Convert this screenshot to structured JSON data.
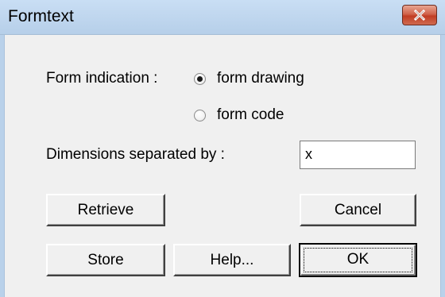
{
  "window": {
    "title": "Formtext"
  },
  "form": {
    "indication_label": "Form indication :",
    "options": [
      {
        "label": "form drawing",
        "selected": true
      },
      {
        "label": "form code",
        "selected": false
      }
    ],
    "separator_label": "Dimensions separated by :",
    "separator_value": "x"
  },
  "buttons": {
    "retrieve": "Retrieve",
    "cancel": "Cancel",
    "store": "Store",
    "help": "Help...",
    "ok": "OK"
  },
  "icons": {
    "close": "close-icon"
  },
  "colors": {
    "titlebar": "#b9d1ea",
    "close_button": "#c94a32",
    "face": "#f0f0f0"
  }
}
